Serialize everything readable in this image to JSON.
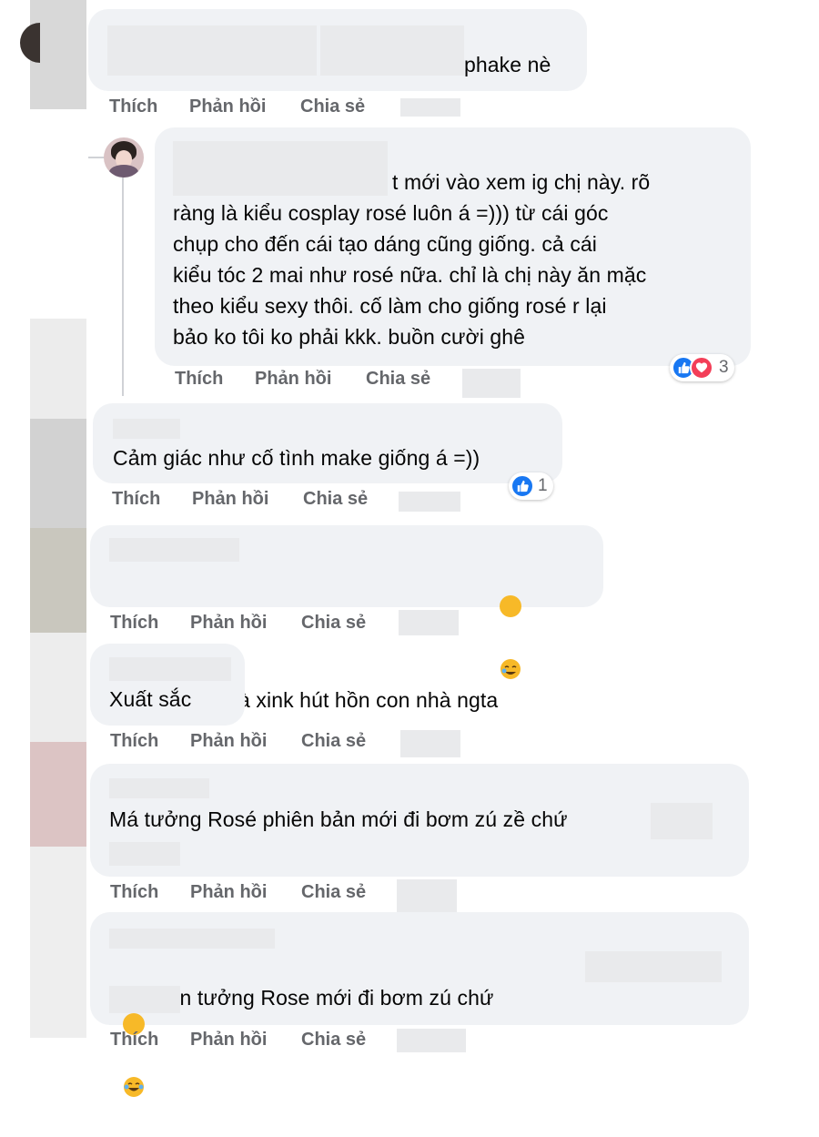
{
  "actions": {
    "like": "Thích",
    "reply": "Phản hồi",
    "share": "Chia sẻ"
  },
  "comments": [
    {
      "text": "phake nè"
    },
    {
      "text": "t mới vào xem ig chị này. rõ\nràng là kiểu cosplay rosé luôn á =))) từ cái góc\nchụp cho đến cái tạo dáng cũng giống. cả cái\nkiểu tóc 2 mai như rosé nữa. chỉ là chị này ăn mặc\ntheo kiểu sexy thôi. cố làm cho giống rosé r lại\nbảo ko tôi ko phải kkk. buồn cười ghê",
      "reaction_count": "3",
      "reactions": [
        "like-icon",
        "love-icon"
      ]
    },
    {
      "text": "Cảm giác như cố tình make giống á =))",
      "reaction_count": "1",
      "reactions": [
        "like-icon"
      ]
    },
    {
      "text": "Uu xink gì mà xink hút hồn con nhà ngta",
      "emoji": "crying-laughing-face"
    },
    {
      "text": "Xuất sắc"
    },
    {
      "text": "Má tưởng Rosé phiên bản mới đi bơm zú zề chứ"
    },
    {
      "text": "hết hồn tưởng Rose mới đi bơm zú chứ",
      "emoji": "tears-of-joy-face"
    }
  ],
  "colors": {
    "bubble": "#f0f2f5",
    "action_text": "#65676b",
    "like_blue": "#1877f2",
    "love_red": "#f33e58"
  }
}
